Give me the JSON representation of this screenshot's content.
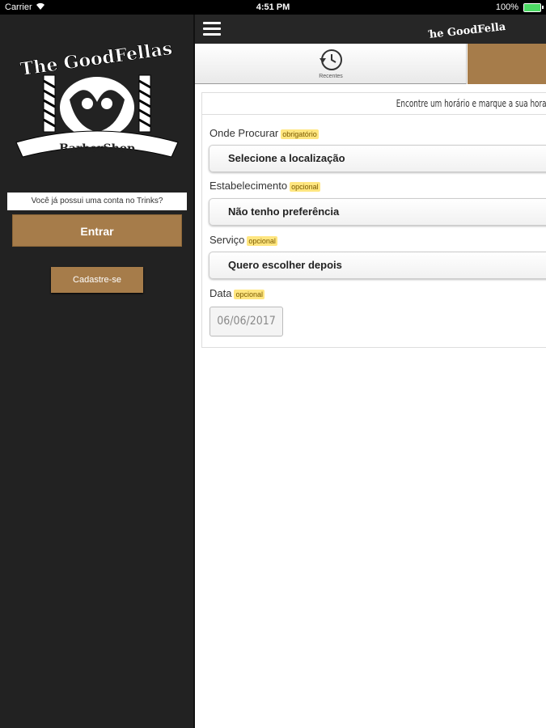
{
  "status_bar": {
    "carrier": "Carrier",
    "time": "4:51 PM",
    "battery": "100%"
  },
  "sidebar": {
    "account_prompt": "Você já possui uma conta no Trinks?",
    "login_label": "Entrar",
    "register_label": "Cadastre-se",
    "logo": {
      "line1": "The GoodFellas",
      "line2": "BarberShop"
    }
  },
  "navbar": {
    "logo": "The GoodFellas"
  },
  "tabs": [
    {
      "label": "Recentes",
      "icon": "history-icon"
    }
  ],
  "form": {
    "headline": "Encontre um horário e marque a sua hora",
    "location": {
      "label": "Onde Procurar",
      "badge": "obrigatório",
      "value": "Selecione a localização"
    },
    "establishment": {
      "label": "Estabelecimento",
      "badge": "opcional",
      "value": "Não tenho preferência"
    },
    "service": {
      "label": "Serviço",
      "badge": "opcional",
      "value": "Quero escolher depois"
    },
    "date": {
      "label": "Data",
      "badge": "opcional",
      "value": "06/06/2017"
    }
  },
  "colors": {
    "accent": "#a67c4a",
    "sidebar_bg": "#222222",
    "badge_bg": "#ffe680"
  }
}
